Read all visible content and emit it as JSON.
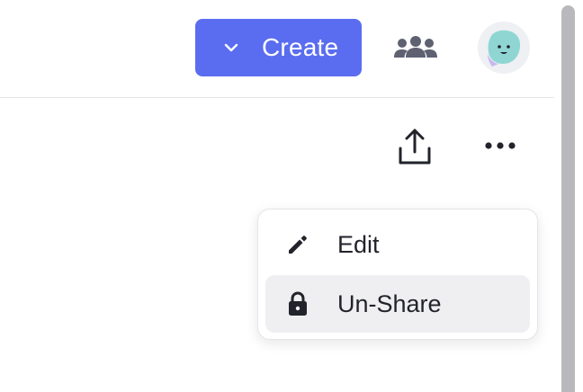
{
  "header": {
    "create_label": "Create",
    "icons": {
      "create_chevron": "chevron-down-icon",
      "team": "team-icon",
      "avatar": "avatar"
    }
  },
  "toolbar": {
    "icons": {
      "share": "share-upload-icon",
      "more": "more-horizontal-icon"
    }
  },
  "menu": {
    "items": [
      {
        "label": "Edit",
        "icon": "pencil-icon",
        "active": false
      },
      {
        "label": "Un-Share",
        "icon": "lock-icon",
        "active": true
      }
    ]
  },
  "colors": {
    "accent": "#5a6df0",
    "avatar_face": "#8fd6d3",
    "menu_hover": "#efeff1",
    "icon": "#22232b"
  }
}
